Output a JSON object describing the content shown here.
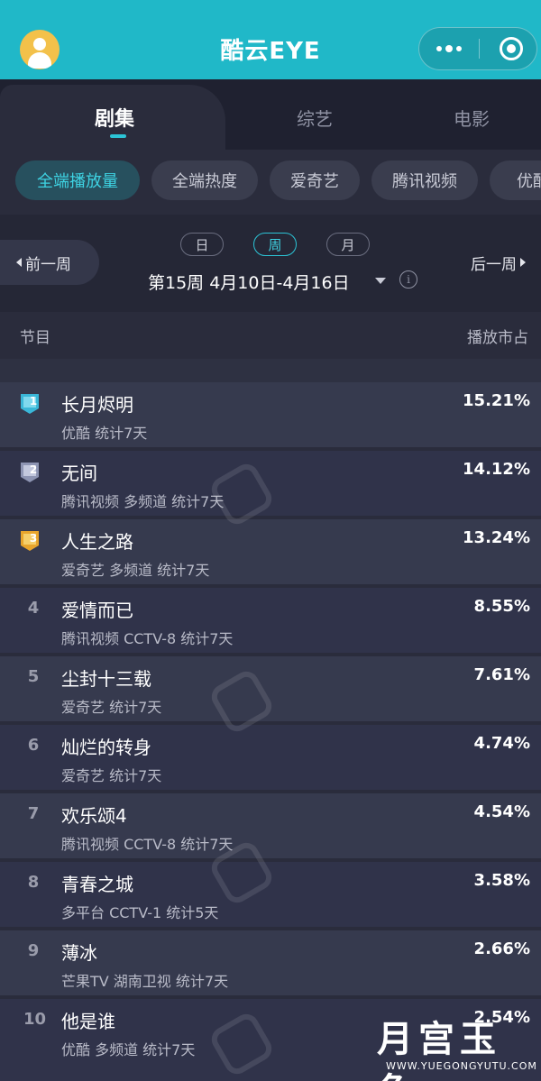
{
  "app": {
    "title": "酷云EYE"
  },
  "category_tabs": [
    {
      "label": "剧集",
      "active": true
    },
    {
      "label": "综艺",
      "active": false
    },
    {
      "label": "电影",
      "active": false
    }
  ],
  "filter_chips": [
    {
      "label": "全端播放量",
      "active": true
    },
    {
      "label": "全端热度",
      "active": false
    },
    {
      "label": "爱奇艺",
      "active": false
    },
    {
      "label": "腾讯视频",
      "active": false
    },
    {
      "label": "优酷",
      "active": false
    }
  ],
  "period": {
    "prev_label": "前一周",
    "next_label": "后一周",
    "granularity": [
      {
        "label": "日",
        "active": false
      },
      {
        "label": "周",
        "active": true
      },
      {
        "label": "月",
        "active": false
      }
    ],
    "week_label": "第15周  4月10日-4月16日"
  },
  "table": {
    "header_left": "节目",
    "header_right": "播放市占",
    "rows": [
      {
        "rank": "1",
        "title": "长月烬明",
        "sub": "优酷 统计7天",
        "share": "15.21%",
        "medal": "blue"
      },
      {
        "rank": "2",
        "title": "无间",
        "sub": "腾讯视频 多频道 统计7天",
        "share": "14.12%",
        "medal": "silver"
      },
      {
        "rank": "3",
        "title": "人生之路",
        "sub": "爱奇艺 多频道 统计7天",
        "share": "13.24%",
        "medal": "gold"
      },
      {
        "rank": "4",
        "title": "爱情而已",
        "sub": "腾讯视频 CCTV-8 统计7天",
        "share": "8.55%"
      },
      {
        "rank": "5",
        "title": "尘封十三载",
        "sub": "爱奇艺 统计7天",
        "share": "7.61%"
      },
      {
        "rank": "6",
        "title": "灿烂的转身",
        "sub": "爱奇艺 统计7天",
        "share": "4.74%"
      },
      {
        "rank": "7",
        "title": "欢乐颂4",
        "sub": "腾讯视频 CCTV-8 统计7天",
        "share": "4.54%"
      },
      {
        "rank": "8",
        "title": "青春之城",
        "sub": "多平台 CCTV-1 统计5天",
        "share": "3.58%"
      },
      {
        "rank": "9",
        "title": "薄冰",
        "sub": "芒果TV 湖南卫视 统计7天",
        "share": "2.66%"
      },
      {
        "rank": "10",
        "title": "他是谁",
        "sub": "优酷 多频道 统计7天",
        "share": "2.54%"
      }
    ]
  },
  "watermark": {
    "brand": "月宫玉兔",
    "url": "WWW.YUEGONGYUTU.COM"
  },
  "colors": {
    "accent": "#2cc4d6",
    "topbar": "#20b8c8",
    "background": "#2a2c3c"
  }
}
